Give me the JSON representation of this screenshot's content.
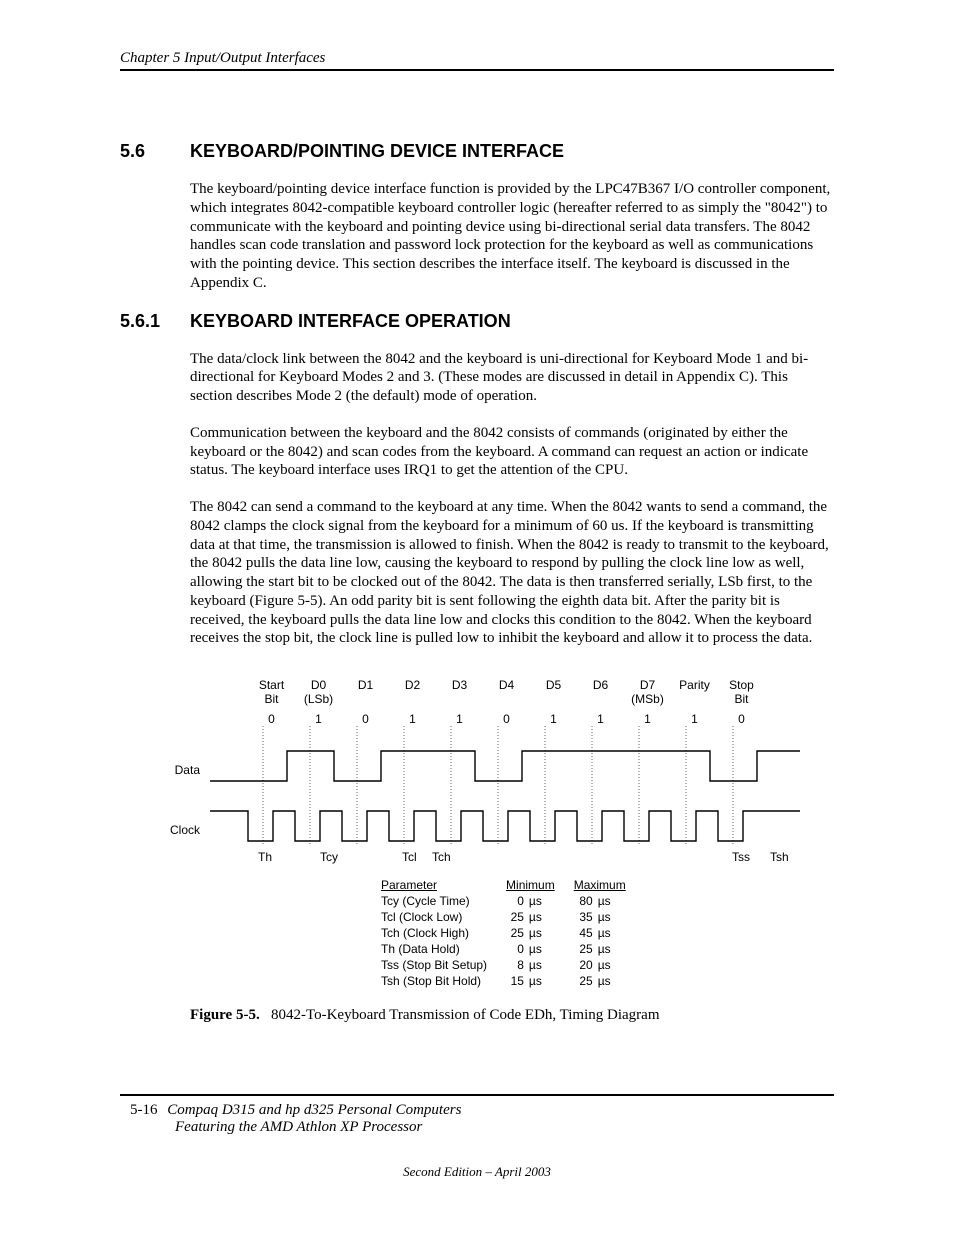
{
  "header": {
    "chapter_line": "Chapter 5  Input/Output Interfaces"
  },
  "sections": {
    "s56": {
      "num": "5.6",
      "title": "KEYBOARD/POINTING DEVICE INTERFACE"
    },
    "s561": {
      "num": "5.6.1",
      "title": "KEYBOARD INTERFACE OPERATION"
    }
  },
  "paragraphs": {
    "p1": "The keyboard/pointing device interface function is provided by the LPC47B367 I/O controller component, which integrates 8042-compatible keyboard controller logic (hereafter referred to as simply the \"8042\") to communicate with the keyboard and pointing device using bi-directional serial data transfers. The 8042 handles scan code translation and password lock protection for the keyboard as well as communications with the pointing device.  This section describes the interface itself. The keyboard is discussed in the Appendix C.",
    "p2": "The data/clock link between the 8042 and the keyboard is uni-directional for Keyboard Mode 1 and bi-directional for Keyboard Modes 2 and 3. (These modes are discussed in detail in Appendix C). This section describes Mode 2 (the default) mode of operation.",
    "p3": "Communication between the keyboard and the 8042 consists of commands (originated by either the keyboard or the 8042) and scan codes from the keyboard. A command can request an action or indicate status. The keyboard interface uses IRQ1 to get the attention of the CPU.",
    "p4": "The 8042 can send a command to the keyboard at any time. When the 8042 wants to send a command, the 8042 clamps the clock signal from the keyboard for a minimum of 60 us. If the keyboard is transmitting data at that time, the transmission is allowed to finish. When the 8042 is ready to transmit to the keyboard,  the 8042 pulls the data line low, causing the keyboard to respond by pulling the clock line low as well, allowing the start bit to be clocked out of the 8042. The data is then transferred serially, LSb first,  to the keyboard (Figure 5-5). An odd parity bit is sent following the eighth data bit. After the parity bit is received, the keyboard pulls the data line low and clocks this condition to the 8042. When the keyboard receives the stop bit, the clock line is pulled low to inhibit the keyboard and allow it to process the data."
  },
  "chart_data": {
    "type": "timing-diagram",
    "title": "8042-To-Keyboard Transmission of Code EDh, Timing Diagram",
    "signals": [
      "Data",
      "Clock"
    ],
    "bit_labels_top": [
      "Start Bit",
      "D0 (LSb)",
      "D1",
      "D2",
      "D3",
      "D4",
      "D5",
      "D6",
      "D7 (MSb)",
      "Parity",
      "Stop Bit"
    ],
    "bit_values": [
      "0",
      "1",
      "0",
      "1",
      "1",
      "0",
      "1",
      "1",
      "1",
      "1",
      "0"
    ],
    "timing_markers": [
      "Th",
      "Tcy",
      "Tcl",
      "Tch",
      "Tss",
      "Tsh"
    ],
    "parameters": {
      "columns": [
        "Parameter",
        "Minimum",
        "Maximum"
      ],
      "rows": [
        {
          "name": "Tcy (Cycle Time)",
          "min": "0 µs",
          "max": "80 µs"
        },
        {
          "name": "Tcl (Clock Low)",
          "min": "25 µs",
          "max": "35 µs"
        },
        {
          "name": "Tch (Clock High)",
          "min": "25 µs",
          "max": "45 µs"
        },
        {
          "name": "Th (Data Hold)",
          "min": "0 µs",
          "max": "25 µs"
        },
        {
          "name": "Tss (Stop Bit Setup)",
          "min": "8 µs",
          "max": "20 µs"
        },
        {
          "name": "Tsh (Stop Bit Hold)",
          "min": "15 µs",
          "max": "25 µs"
        }
      ]
    }
  },
  "figure": {
    "label": "Figure 5-5.",
    "caption": "8042-To-Keyboard Transmission of Code EDh, Timing Diagram"
  },
  "footer": {
    "page": "5-16",
    "title1": "Compaq D315 and hp d325 Personal Computers",
    "title2": "Featuring the AMD Athlon XP Processor",
    "edition": "Second Edition – April 2003"
  }
}
